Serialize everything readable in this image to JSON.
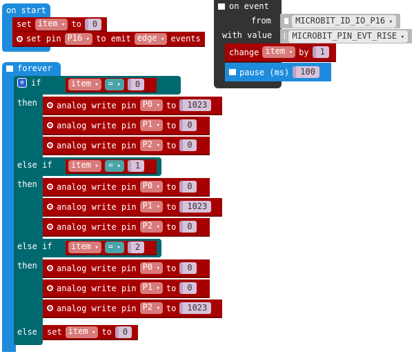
{
  "on_start": {
    "title": "on start",
    "set": {
      "label": "set",
      "var": "item",
      "to": "to",
      "value": "0"
    },
    "set_pin": {
      "label": "set pin",
      "pin": "P16",
      "to": "to emit",
      "edge": "edge",
      "events": "events"
    }
  },
  "on_event": {
    "title": "on event",
    "from_label": "from",
    "from_value": "MICROBIT_ID_IO_P16",
    "with_label": "with value",
    "with_value": "MICROBIT_PIN_EVT_RISE",
    "change": {
      "label": "change",
      "var": "item",
      "by": "by",
      "value": "1"
    },
    "pause": {
      "label": "pause (ms)",
      "value": "100"
    }
  },
  "forever": {
    "title": "forever",
    "if_label": "if",
    "then_label": "then",
    "elseif_label": "else if",
    "else_label": "else",
    "branches": [
      {
        "var": "item",
        "op": "=",
        "value": "0",
        "writes": [
          {
            "pin": "P0",
            "value": "1023"
          },
          {
            "pin": "P1",
            "value": "0"
          },
          {
            "pin": "P2",
            "value": "0"
          }
        ]
      },
      {
        "var": "item",
        "op": "=",
        "value": "1",
        "writes": [
          {
            "pin": "P0",
            "value": "0"
          },
          {
            "pin": "P1",
            "value": "1023"
          },
          {
            "pin": "P2",
            "value": "0"
          }
        ]
      },
      {
        "var": "item",
        "op": "=",
        "value": "2",
        "writes": [
          {
            "pin": "P0",
            "value": "0"
          },
          {
            "pin": "P1",
            "value": "0"
          },
          {
            "pin": "P2",
            "value": "1023"
          }
        ]
      }
    ],
    "write_label": "analog write pin",
    "write_to": "to",
    "else_set": {
      "label": "set",
      "var": "item",
      "to": "to",
      "value": "0"
    }
  },
  "colors": {
    "events": "#1e8cdc",
    "variables": "#a60000",
    "logic": "#006970",
    "control": "#333333"
  }
}
